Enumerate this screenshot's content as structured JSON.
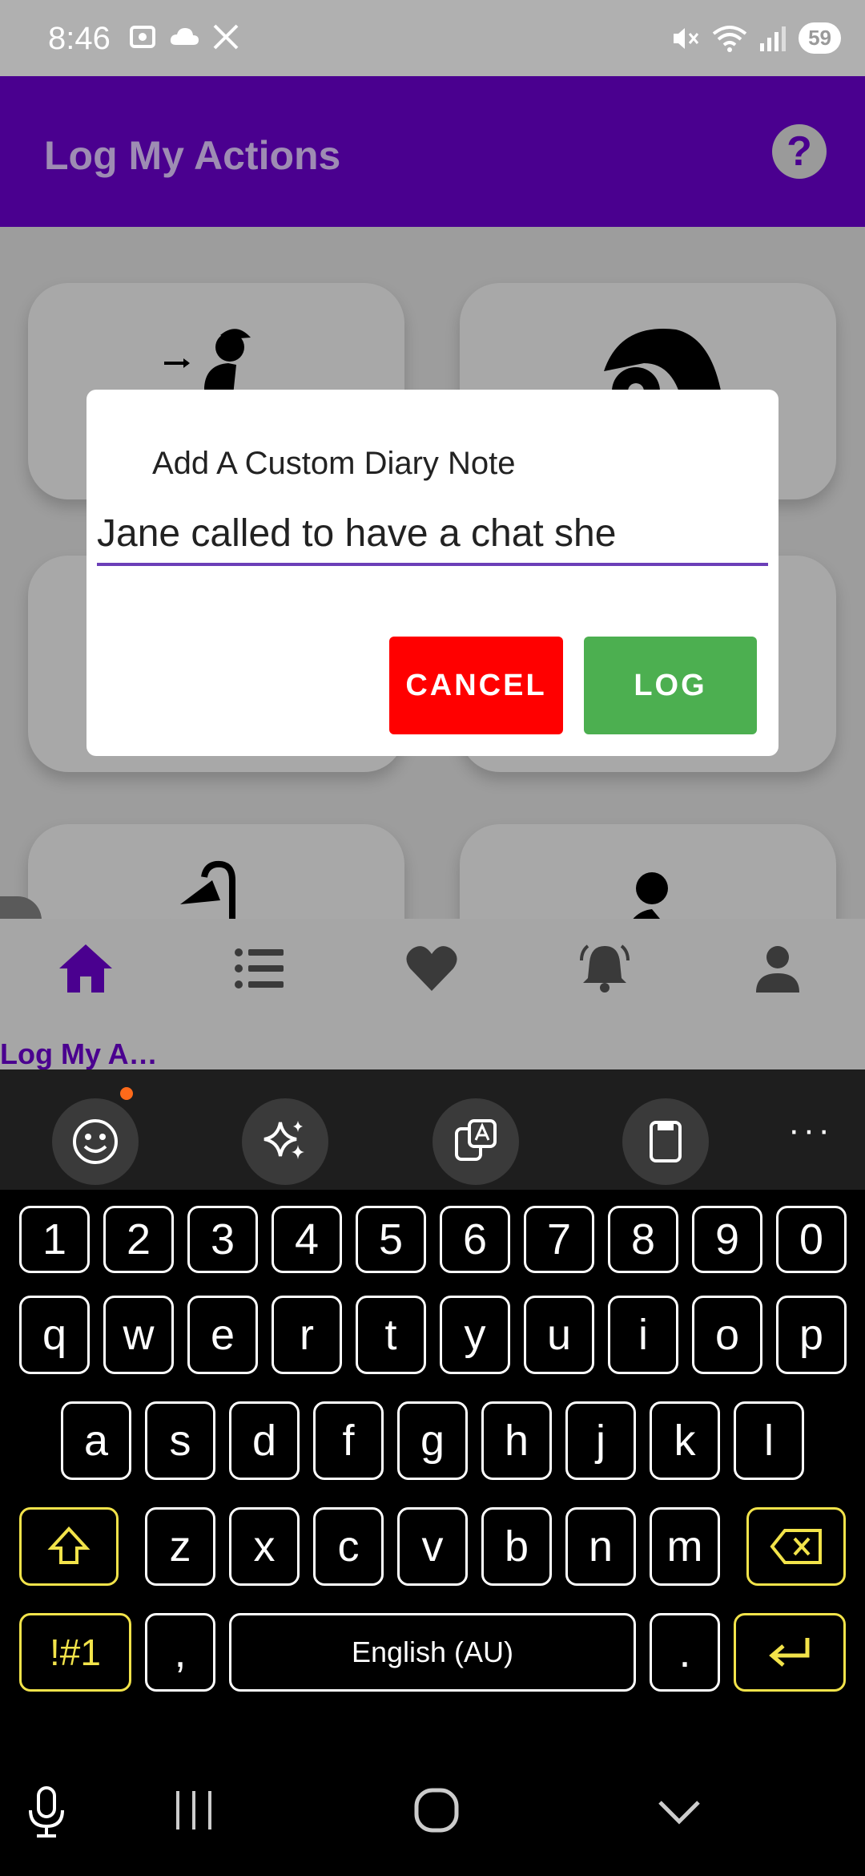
{
  "status_bar": {
    "time": "8:46",
    "battery": "59",
    "left_icons": [
      "screenshot-icon",
      "cloud-icon",
      "x-icon"
    ],
    "right_icons": [
      "mute-icon",
      "wifi-icon",
      "signal-icon"
    ]
  },
  "app_bar": {
    "title": "Log My Actions",
    "help_label": "?"
  },
  "dialog": {
    "title": "Add A Custom Diary Note",
    "input_value": "Jane called to have a chat she",
    "cancel_label": "CANCEL",
    "log_label": "LOG"
  },
  "bottom_nav": {
    "items": [
      {
        "icon": "home-icon",
        "label": "Log My A…",
        "active": true
      },
      {
        "icon": "list-icon",
        "label": ""
      },
      {
        "icon": "heart-icon",
        "label": ""
      },
      {
        "icon": "bell-icon",
        "label": ""
      },
      {
        "icon": "person-icon",
        "label": ""
      }
    ],
    "active_color": "#4a008f"
  },
  "keyboard": {
    "toolbar": [
      "emoji-icon",
      "sparkle-icon",
      "translate-icon",
      "clipboard-icon",
      "more-icon"
    ],
    "more_label": "···",
    "row_numbers": [
      "1",
      "2",
      "3",
      "4",
      "5",
      "6",
      "7",
      "8",
      "9",
      "0"
    ],
    "row_1": [
      "q",
      "w",
      "e",
      "r",
      "t",
      "y",
      "u",
      "i",
      "o",
      "p"
    ],
    "row_2": [
      "a",
      "s",
      "d",
      "f",
      "g",
      "h",
      "j",
      "k",
      "l"
    ],
    "row_3": [
      "z",
      "x",
      "c",
      "v",
      "b",
      "n",
      "m"
    ],
    "symbols_label": "!#1",
    "comma_label": ",",
    "space_label": "English (AU)",
    "period_label": ".",
    "accent_color": "#f2e34a"
  },
  "colors": {
    "app_bar": "#4a008f",
    "cancel": "#ff0000",
    "log": "#4caf50",
    "input_underline": "#6b3fb8"
  }
}
